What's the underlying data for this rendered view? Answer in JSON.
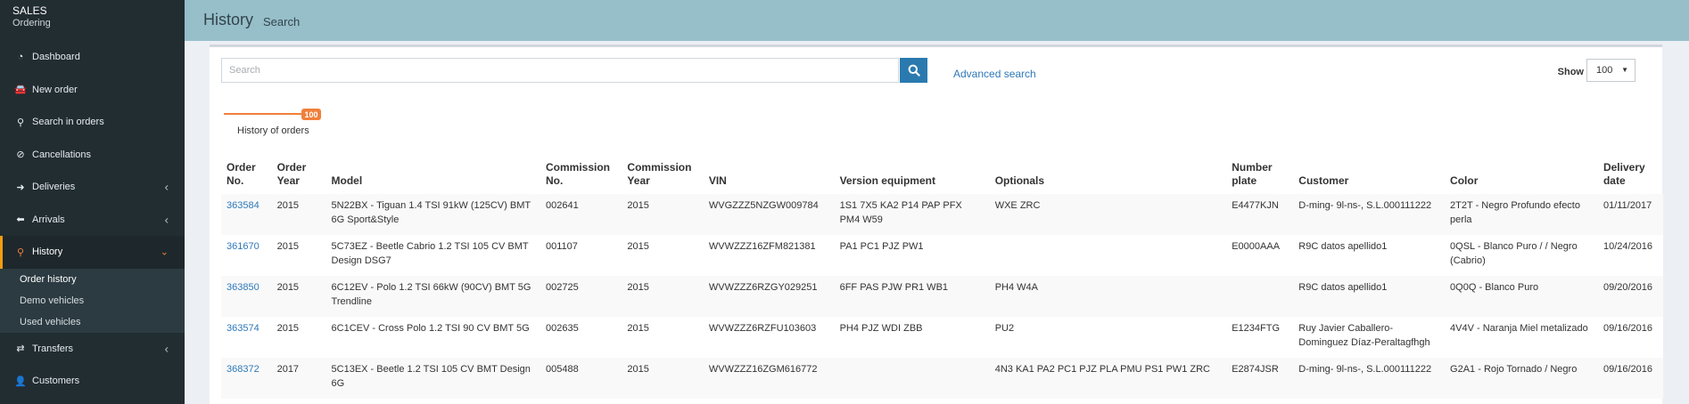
{
  "app": {
    "title": "SALES",
    "subtitle": "Ordering"
  },
  "sidebar": {
    "items": [
      {
        "label": "Dashboard",
        "icon": "gauge-icon",
        "glyph": "◔"
      },
      {
        "label": "New order",
        "icon": "car-icon",
        "glyph": "🚘"
      },
      {
        "label": "Search in orders",
        "icon": "search-icon",
        "glyph": "⚲"
      },
      {
        "label": "Cancellations",
        "icon": "ban-icon",
        "glyph": "⊘"
      },
      {
        "label": "Deliveries",
        "icon": "arrow-right-icon",
        "glyph": "➜"
      },
      {
        "label": "Arrivals",
        "icon": "arrow-left-icon",
        "glyph": "⬅"
      },
      {
        "label": "History",
        "icon": "search-icon",
        "glyph": "⚲"
      },
      {
        "label": "Transfers",
        "icon": "exchange-icon",
        "glyph": "⇄"
      },
      {
        "label": "Customers",
        "icon": "user-icon",
        "glyph": "👤"
      }
    ],
    "submenu": [
      "Order history",
      "Demo vehicles",
      "Used vehicles"
    ]
  },
  "header": {
    "title": "History",
    "breadcrumb": "Search"
  },
  "search": {
    "placeholder": "Search",
    "value": "",
    "advanced_label": "Advanced search"
  },
  "show": {
    "label": "Show",
    "value": "100"
  },
  "tab": {
    "label": "History of orders",
    "badge": "100"
  },
  "table": {
    "columns": [
      "Order No.",
      "Order Year",
      "Model",
      "Commission No.",
      "Commission Year",
      "VIN",
      "Version equipment",
      "Optionals",
      "Number plate",
      "Customer",
      "Color",
      "Delivery date"
    ],
    "rows": [
      [
        "363584",
        "2015",
        "5N22BX - Tiguan 1.4 TSI 91kW (125CV) BMT 6G Sport&Style",
        "002641",
        "2015",
        "WVGZZZ5NZGW009784",
        "1S1 7X5 KA2 P14 PAP PFX PM4 W59",
        "WXE ZRC",
        "E4477KJN",
        "D-ming- 9l-ns-, S.L.000111222",
        "2T2T - Negro Profundo efecto perla",
        "01/11/2017"
      ],
      [
        "361670",
        "2015",
        "5C73EZ - Beetle Cabrio 1.2 TSI 105 CV BMT Design DSG7",
        "001107",
        "2015",
        "WVWZZZ16ZFM821381",
        "PA1 PC1 PJZ PW1",
        "",
        "E0000AAA",
        "R9C datos apellido1",
        "0QSL - Blanco Puro / / Negro (Cabrio)",
        "10/24/2016"
      ],
      [
        "363850",
        "2015",
        "6C12EV - Polo 1.2 TSI 66kW (90CV) BMT 5G Trendline",
        "002725",
        "2015",
        "WVWZZZ6RZGY029251",
        "6FF PAS PJW PR1 WB1",
        "PH4 W4A",
        "",
        "R9C datos apellido1",
        "0Q0Q - Blanco Puro",
        "09/20/2016"
      ],
      [
        "363574",
        "2015",
        "6C1CEV - Cross Polo 1.2 TSI 90 CV BMT 5G",
        "002635",
        "2015",
        "WVWZZZ6RZFU103603",
        "PH4 PJZ WDI ZBB",
        "PU2",
        "E1234FTG",
        "Ruy Javier Caballero-Dominguez Díaz-Peraltagfhgh",
        "4V4V - Naranja Miel metalizado",
        "09/16/2016"
      ],
      [
        "368372",
        "2017",
        "5C13EX - Beetle 1.2 TSI 105 CV BMT Design 6G",
        "005488",
        "2015",
        "WVWZZZ16ZGM616772",
        "",
        "4N3 KA1 PA2 PC1 PJZ PLA PMU PS1 PW1 ZRC",
        "E2874JSR",
        "D-ming- 9l-ns-, S.L.000111222",
        "G2A1 - Rojo Tornado / Negro",
        "09/16/2016"
      ]
    ]
  },
  "colors": {
    "sidebar": "#222d32",
    "header": "#96bfca",
    "accent": "#f0803c",
    "link": "#2f79b9",
    "button": "#2a7ab0"
  }
}
